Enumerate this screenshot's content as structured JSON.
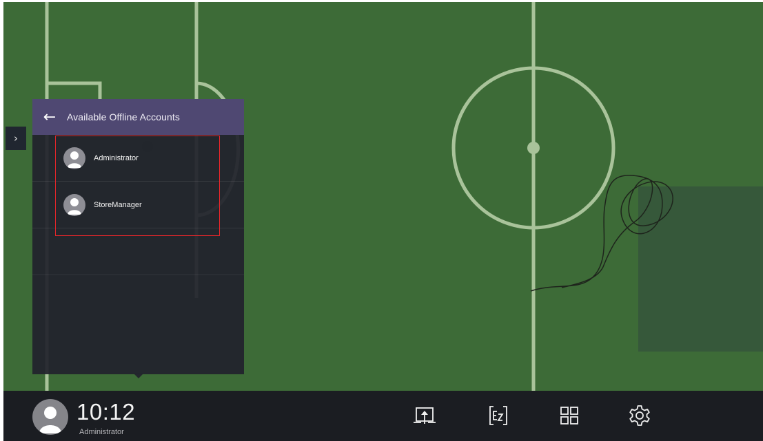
{
  "colors": {
    "field_green": "#3d6b37",
    "field_lines": "#a9c39a",
    "panel_header": "#4f4872",
    "panel_body": "#21222c",
    "taskbar": "#1b1d22",
    "highlight": "#e3262a"
  },
  "side_handle": {
    "icon": "chevron-right-icon",
    "glyph": "›"
  },
  "account_panel": {
    "back_icon": "back-arrow-icon",
    "back_glyph": "←",
    "title": "Available Offline Accounts",
    "accounts": [
      {
        "name": "Administrator",
        "icon": "user-avatar-icon"
      },
      {
        "name": "StoreManager",
        "icon": "user-avatar-icon"
      }
    ]
  },
  "taskbar": {
    "time": "10:12",
    "user": "Administrator",
    "icons": [
      {
        "name": "screen-share-icon"
      },
      {
        "name": "ez-write-icon"
      },
      {
        "name": "apps-grid-icon"
      },
      {
        "name": "settings-gear-icon"
      }
    ]
  }
}
